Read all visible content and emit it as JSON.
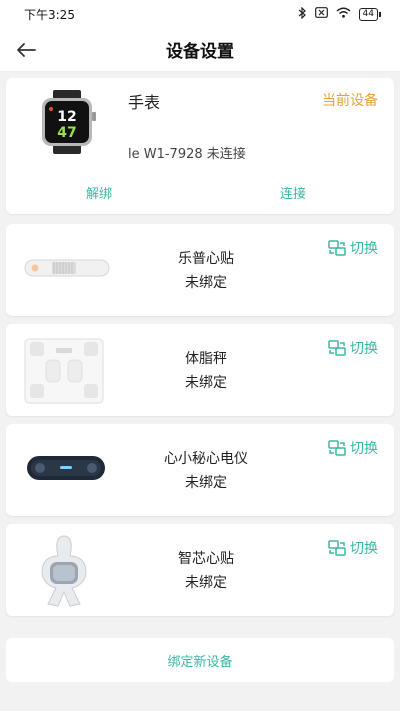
{
  "status_bar": {
    "time": "下午3:25",
    "battery": "44"
  },
  "header": {
    "title": "设备设置"
  },
  "current_device": {
    "name": "手表",
    "badge": "当前设备",
    "device_id": "le W1-7928 未连接",
    "unbind_label": "解绑",
    "connect_label": "连接",
    "watch_time_top": "12",
    "watch_time_bottom": "47"
  },
  "devices": [
    {
      "name": "乐普心贴",
      "status": "未绑定",
      "switch_label": "切换",
      "image": "patch-strip"
    },
    {
      "name": "体脂秤",
      "status": "未绑定",
      "switch_label": "切换",
      "image": "body-fat-scale"
    },
    {
      "name": "心小秘心电仪",
      "status": "未绑定",
      "switch_label": "切换",
      "image": "ecg-device"
    },
    {
      "name": "智芯心贴",
      "status": "未绑定",
      "switch_label": "切换",
      "image": "chip-patch"
    }
  ],
  "bind_new_label": "绑定新设备",
  "colors": {
    "accent": "#3ab8a4",
    "badge": "#e3a43a",
    "background": "#f2f2f2"
  }
}
